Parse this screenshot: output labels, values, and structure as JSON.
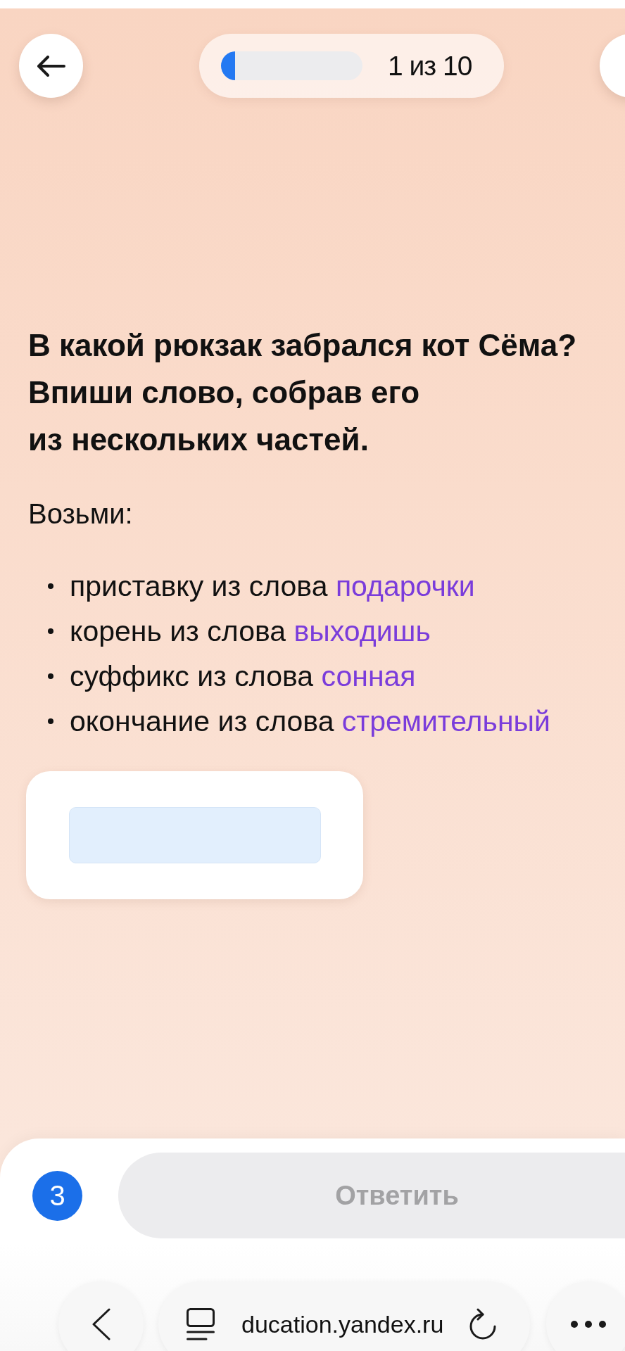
{
  "progress": {
    "level": 0.1,
    "label": "1 из 10"
  },
  "question": "В какой рюкзак забрался кот Сёма?\nВпиши слово, собрав его\nиз нескольких частей.",
  "instruction": "Возьми:",
  "parts": [
    {
      "text": "приставку из слова",
      "word": "подарочки"
    },
    {
      "text": "корень из слова",
      "word": "выходишь"
    },
    {
      "text": "суффикс из слова",
      "word": "сонная"
    },
    {
      "text": "окончание из слова",
      "word": "стремительный"
    }
  ],
  "answer_bar": {
    "counter": "3",
    "submit": {
      "label": "Ответить",
      "disabled": true
    }
  },
  "browser": {
    "url": "ducation.yandex.ru"
  }
}
